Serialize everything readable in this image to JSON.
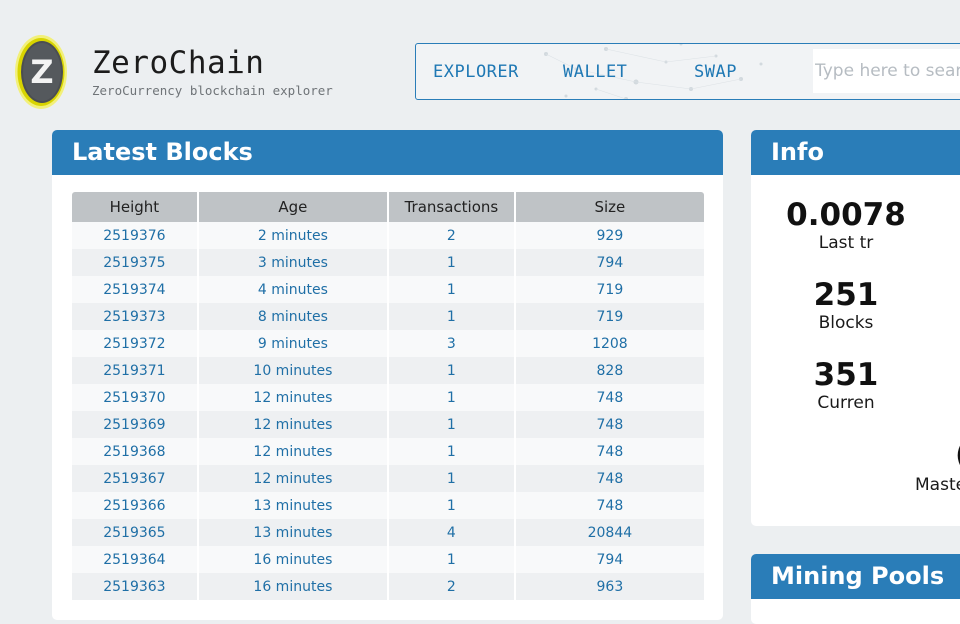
{
  "brand": {
    "logo_letter": "Z",
    "title": "ZeroChain",
    "subtitle": "ZeroCurrency blockchain explorer"
  },
  "nav": {
    "items": [
      {
        "label": "EXPLORER"
      },
      {
        "label": "WALLET"
      },
      {
        "label": "SWAP"
      }
    ],
    "search_placeholder": "Type here to search"
  },
  "latest_blocks": {
    "title": "Latest Blocks",
    "columns": [
      "Height",
      "Age",
      "Transactions",
      "Size"
    ],
    "rows": [
      {
        "height": "2519376",
        "age": "2 minutes",
        "tx": "2",
        "size": "929"
      },
      {
        "height": "2519375",
        "age": "3 minutes",
        "tx": "1",
        "size": "794"
      },
      {
        "height": "2519374",
        "age": "4 minutes",
        "tx": "1",
        "size": "719"
      },
      {
        "height": "2519373",
        "age": "8 minutes",
        "tx": "1",
        "size": "719"
      },
      {
        "height": "2519372",
        "age": "9 minutes",
        "tx": "3",
        "size": "1208"
      },
      {
        "height": "2519371",
        "age": "10 minutes",
        "tx": "1",
        "size": "828"
      },
      {
        "height": "2519370",
        "age": "12 minutes",
        "tx": "1",
        "size": "748"
      },
      {
        "height": "2519369",
        "age": "12 minutes",
        "tx": "1",
        "size": "748"
      },
      {
        "height": "2519368",
        "age": "12 minutes",
        "tx": "1",
        "size": "748"
      },
      {
        "height": "2519367",
        "age": "12 minutes",
        "tx": "1",
        "size": "748"
      },
      {
        "height": "2519366",
        "age": "13 minutes",
        "tx": "1",
        "size": "748"
      },
      {
        "height": "2519365",
        "age": "13 minutes",
        "tx": "4",
        "size": "20844"
      },
      {
        "height": "2519364",
        "age": "16 minutes",
        "tx": "1",
        "size": "794"
      },
      {
        "height": "2519363",
        "age": "16 minutes",
        "tx": "2",
        "size": "963"
      }
    ]
  },
  "info": {
    "title": "Info",
    "stats": [
      {
        "value": "0.0078",
        "label": "Last tr"
      },
      {
        "value": "251",
        "label": "Blocks"
      },
      {
        "value": "351",
        "label": "Curren"
      },
      {
        "value": "(",
        "label": "Maste"
      }
    ]
  },
  "mining": {
    "title": "Mining Pools"
  },
  "colors": {
    "accent": "#2a7db8",
    "link": "#1f6fa6",
    "background": "#eceff1",
    "table_header": "#bfc3c6",
    "logo_ring": "#e6e600"
  }
}
